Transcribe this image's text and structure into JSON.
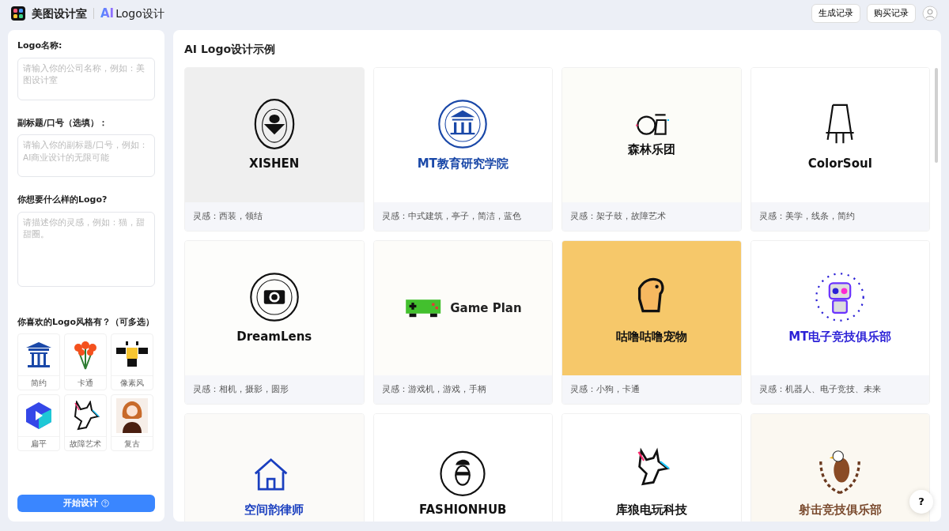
{
  "header": {
    "brand": "美图设计室",
    "product_ai": "AI",
    "product": "Logo设计",
    "buttons": [
      "生成记录",
      "购买记录"
    ]
  },
  "form": {
    "fields": [
      {
        "label": "Logo名称:",
        "placeholder": "请输入你的公司名称，例如：美图设计室"
      },
      {
        "label": "副标题/口号（选填）：",
        "placeholder": "请输入你的副标题/口号，例如：AI商业设计的无限可能"
      },
      {
        "label": "你想要什么样的Logo?",
        "placeholder": "请描述你的灵感，例如：猫，甜甜圈。"
      }
    ],
    "styles_label": "你喜欢的Logo风格有？（可多选）",
    "styles": [
      {
        "label": "简约",
        "selected": false
      },
      {
        "label": "卡通",
        "selected": false
      },
      {
        "label": "像素风",
        "selected": false
      },
      {
        "label": "扁平",
        "selected": false
      },
      {
        "label": "故障艺术",
        "selected": false
      },
      {
        "label": "复古",
        "selected": false
      }
    ],
    "submit": "开始设计"
  },
  "gallery": {
    "title": "AI Logo设计示例",
    "cards": [
      {
        "wordmark": "XISHEN",
        "caption": "灵感：西装，领结"
      },
      {
        "wordmark": "MT教育研究学院",
        "caption": "灵感：中式建筑，亭子，简洁，蓝色"
      },
      {
        "wordmark": "森林乐团",
        "caption": "灵感：架子鼓，故障艺术"
      },
      {
        "wordmark": "ColorSoul",
        "caption": "灵感：美学，线条，简约"
      },
      {
        "wordmark": "DreamLens",
        "caption": "灵感：相机，摄影，圆形"
      },
      {
        "wordmark": "Game Plan",
        "caption": "灵感：游戏机，游戏，手柄"
      },
      {
        "wordmark": "咕噜咕噜宠物",
        "caption": "灵感：小狗，卡通"
      },
      {
        "wordmark": "MT电子竞技俱乐部",
        "caption": "灵感：机器人、电子竞技、未来"
      },
      {
        "wordmark": "空间韵律师"
      },
      {
        "wordmark": "FASHIONHUB"
      },
      {
        "wordmark": "库狼电玩科技"
      },
      {
        "wordmark": "射击竞技俱乐部"
      }
    ]
  },
  "help": "?"
}
